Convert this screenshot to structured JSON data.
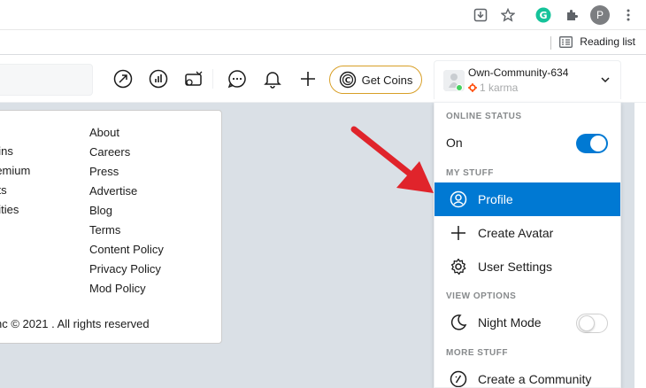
{
  "browser": {
    "profile_initial": "P",
    "reading_list_label": "Reading list",
    "icons": [
      "install-icon",
      "star-icon",
      "grammarly-icon",
      "extensions-icon",
      "profile-avatar",
      "menu-icon"
    ]
  },
  "header": {
    "get_coins_label": "Get Coins",
    "username": "Own-Community-634",
    "karma": "1 karma",
    "icons": [
      "popular-icon",
      "stats-icon",
      "coins-video-icon",
      "chat-icon",
      "notification-icon",
      "plus-icon"
    ]
  },
  "footer": {
    "col1": [
      "oins",
      "remium",
      "ifts",
      "nities"
    ],
    "col2": [
      "About",
      "Careers",
      "Press",
      "Advertise",
      "Blog",
      "Terms",
      "Content Policy",
      "Privacy Policy",
      "Mod Policy"
    ],
    "copyright": "nc © 2021 . All rights reserved"
  },
  "dropdown": {
    "online_status_label": "ONLINE STATUS",
    "online_value": "On",
    "online_toggle": true,
    "my_stuff_label": "MY STUFF",
    "profile": "Profile",
    "create_avatar": "Create Avatar",
    "user_settings": "User Settings",
    "view_options_label": "VIEW OPTIONS",
    "night_mode": "Night Mode",
    "night_mode_toggle": false,
    "more_stuff_label": "MORE STUFF",
    "create_community": "Create a Community"
  },
  "colors": {
    "accent": "#0079d3",
    "annotation_arrow": "#e0242b",
    "coins_border": "#d89f27",
    "online_dot": "#46d160"
  }
}
